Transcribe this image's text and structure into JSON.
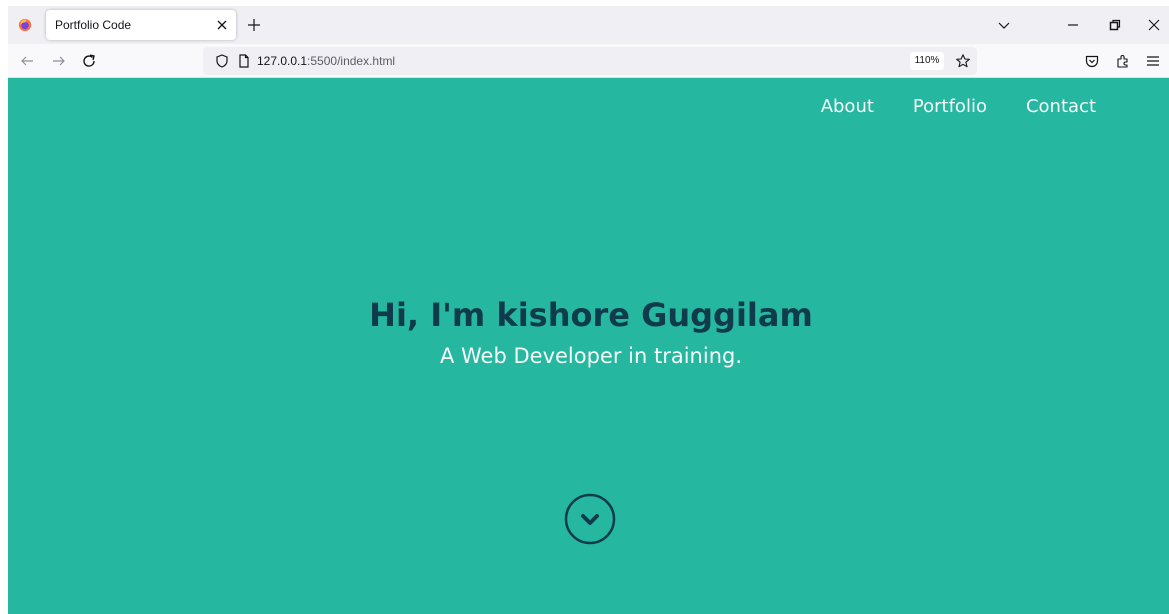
{
  "browser": {
    "tab": {
      "title": "Portfolio Code"
    },
    "url": {
      "host": "127.0.0.1",
      "path": ":5500/index.html"
    },
    "zoom": "110%"
  },
  "site": {
    "nav": {
      "about": "About",
      "portfolio": "Portfolio",
      "contact": "Contact"
    },
    "hero": {
      "title": "Hi, I'm kishore Guggilam",
      "subtitle": "A Web Developer in training."
    }
  },
  "colors": {
    "page_background": "#26b7a1",
    "title": "#0f3b4b",
    "light_text": "#f4fbf9"
  },
  "icons": {
    "browser": [
      "firefox-logo-icon",
      "close-icon",
      "plus-icon",
      "chevron-down-icon",
      "minimize-icon",
      "restore-icon",
      "back-arrow-icon",
      "forward-arrow-icon",
      "reload-icon",
      "shield-icon",
      "page-icon",
      "star-icon",
      "pocket-icon",
      "extensions-icon",
      "hamburger-menu-icon"
    ],
    "page": [
      "chevron-down-circle-icon"
    ]
  }
}
